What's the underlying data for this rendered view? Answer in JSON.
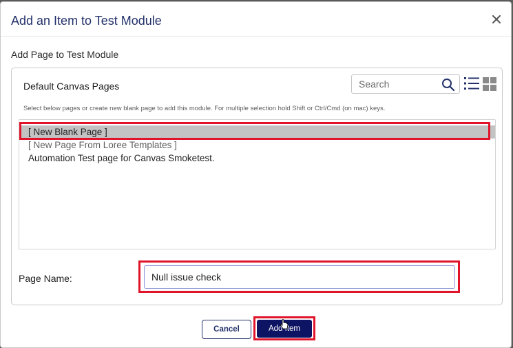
{
  "dialog": {
    "title": "Add an Item to Test Module",
    "section_label": "Add Page to Test Module"
  },
  "panel": {
    "title": "Default Canvas Pages",
    "search_placeholder": "Search",
    "hint": "Select below pages or create new blank page to add this module. For multiple selection hold Shift or Ctrl/Cmd (on mac) keys.",
    "pages": [
      {
        "label": "[ New Blank Page ]",
        "selected": true
      },
      {
        "label": "[ New Page From Loree Templates ]",
        "selected": false
      },
      {
        "label": "Automation Test page for Canvas Smoketest.",
        "selected": false
      }
    ]
  },
  "page_name": {
    "label": "Page Name:",
    "value": "Null issue check"
  },
  "buttons": {
    "cancel": "Cancel",
    "add": "Add Item"
  },
  "icons": {
    "close": "close-icon",
    "search": "search-icon",
    "list_view": "list-view-icon",
    "grid_view": "grid-view-icon"
  },
  "colors": {
    "title": "#23316b",
    "primary_button": "#0d1463",
    "highlight": "#e0152b",
    "selected_row": "#c3c3c3"
  }
}
